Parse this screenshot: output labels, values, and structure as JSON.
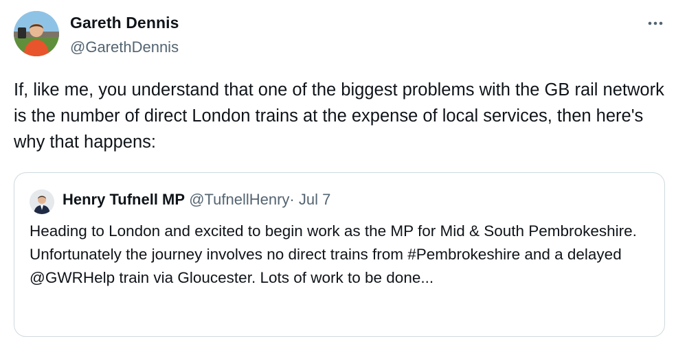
{
  "tweet": {
    "author": {
      "name": "Gareth Dennis",
      "handle": "@GarethDennis"
    },
    "text": "If, like me, you understand that one of the biggest problems with the GB rail network is the number of direct London trains at the expense of local services, then here's why that happens:",
    "more_icon": "more-horizontal-icon"
  },
  "quote": {
    "author": {
      "name": "Henry Tufnell MP",
      "handle": "@TufnellHenry",
      "separator": "·",
      "date": "Jul 7"
    },
    "text": "Heading to London and excited to begin work as the MP for Mid & South Pembrokeshire. Unfortunately the journey involves no direct trains from #Pembrokeshire and a delayed @GWRHelp train via Gloucester. Lots of work to be done..."
  }
}
